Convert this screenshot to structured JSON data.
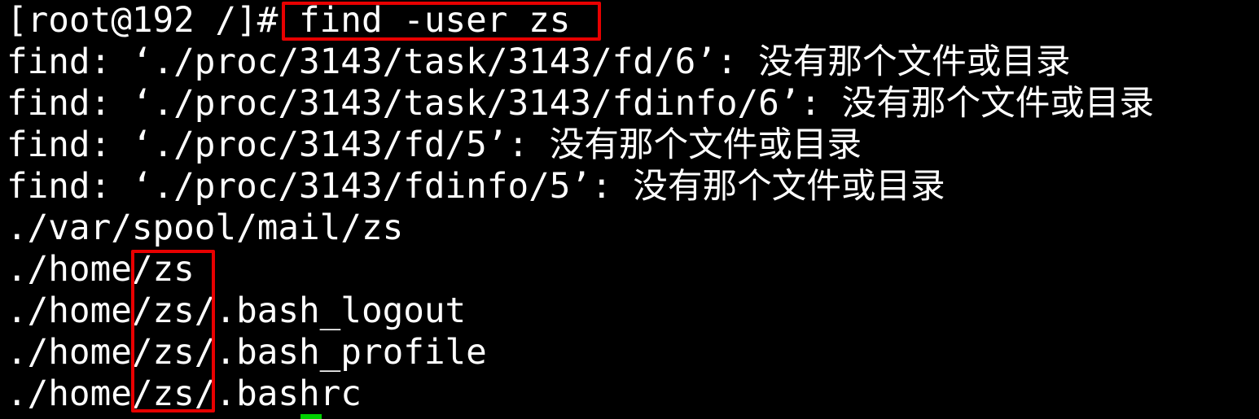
{
  "terminal": {
    "prompt": "[root@192 /]# ",
    "command": "find -user zs",
    "output_lines": [
      "find: ‘./proc/3143/task/3143/fd/6’: 没有那个文件或目录",
      "find: ‘./proc/3143/task/3143/fdinfo/6’: 没有那个文件或目录",
      "find: ‘./proc/3143/fd/5’: 没有那个文件或目录",
      "find: ‘./proc/3143/fdinfo/5’: 没有那个文件或目录",
      "./var/spool/mail/zs",
      "./home/zs",
      "./home/zs/.bash_logout",
      "./home/zs/.bash_profile",
      "./home/zs/.bashrc"
    ]
  },
  "colors": {
    "background": "#000000",
    "text": "#ffffff",
    "annotation": "#e80000",
    "cursor": "#00d000"
  }
}
